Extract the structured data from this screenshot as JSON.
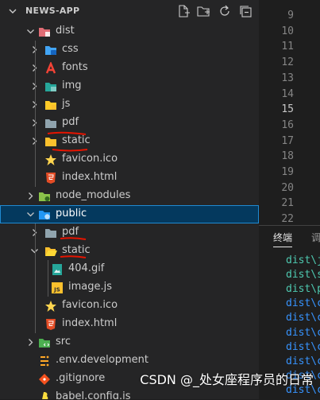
{
  "explorer": {
    "title": "NEWS-APP",
    "actions": [
      {
        "name": "new-file-icon"
      },
      {
        "name": "new-folder-icon"
      },
      {
        "name": "refresh-icon"
      },
      {
        "name": "collapse-all-icon"
      }
    ],
    "tree": [
      {
        "label": "dist",
        "type": "folder",
        "expanded": true,
        "depth": 0,
        "icon": "dist-folder-icon"
      },
      {
        "label": "css",
        "type": "folder",
        "expanded": false,
        "depth": 1,
        "icon": "css-folder-icon"
      },
      {
        "label": "fonts",
        "type": "folder",
        "expanded": false,
        "depth": 1,
        "icon": "fonts-folder-icon"
      },
      {
        "label": "img",
        "type": "folder",
        "expanded": false,
        "depth": 1,
        "icon": "img-folder-icon"
      },
      {
        "label": "js",
        "type": "folder",
        "expanded": false,
        "depth": 1,
        "icon": "js-folder-icon"
      },
      {
        "label": "pdf",
        "type": "folder",
        "expanded": false,
        "depth": 1,
        "icon": "folder-icon"
      },
      {
        "label": "static",
        "type": "folder",
        "expanded": false,
        "depth": 1,
        "icon": "static-folder-icon"
      },
      {
        "label": "favicon.ico",
        "type": "file",
        "depth": 1,
        "icon": "favicon-file-icon"
      },
      {
        "label": "index.html",
        "type": "file",
        "depth": 1,
        "icon": "html-file-icon"
      },
      {
        "label": "node_modules",
        "type": "folder",
        "expanded": false,
        "depth": 0,
        "icon": "node-modules-folder-icon"
      },
      {
        "label": "public",
        "type": "folder",
        "expanded": true,
        "depth": 0,
        "icon": "public-folder-icon",
        "selected": true
      },
      {
        "label": "pdf",
        "type": "folder",
        "expanded": false,
        "depth": 1,
        "icon": "folder-icon"
      },
      {
        "label": "static",
        "type": "folder",
        "expanded": true,
        "depth": 1,
        "icon": "static-folder-open-icon"
      },
      {
        "label": "404.gif",
        "type": "file",
        "depth": 2,
        "icon": "image-file-icon"
      },
      {
        "label": "image.js",
        "type": "file",
        "depth": 2,
        "icon": "js-file-icon"
      },
      {
        "label": "favicon.ico",
        "type": "file",
        "depth": 1,
        "icon": "favicon-file-icon"
      },
      {
        "label": "index.html",
        "type": "file",
        "depth": 1,
        "icon": "html-file-icon"
      },
      {
        "label": "src",
        "type": "folder",
        "expanded": false,
        "depth": 0,
        "icon": "src-folder-icon"
      },
      {
        "label": ".env.development",
        "type": "file",
        "depth": 0,
        "icon": "env-file-icon"
      },
      {
        "label": ".gitignore",
        "type": "file",
        "depth": 0,
        "icon": "git-file-icon"
      },
      {
        "label": "babel.config.js",
        "type": "file",
        "depth": 0,
        "icon": "babel-file-icon"
      }
    ]
  },
  "editor": {
    "line_numbers": [
      "9",
      "10",
      "11",
      "12",
      "13",
      "14",
      "15",
      "16",
      "17",
      "18",
      "19",
      "20",
      "21",
      "22",
      "23"
    ],
    "active_line": "15"
  },
  "panel": {
    "tab_active": "终端",
    "tab_other": "调",
    "terminal_lines": [
      {
        "text": "dist\\j",
        "color": "#4ec9b0"
      },
      {
        "text": "dist\\s",
        "color": "#4ec9b0"
      },
      {
        "text": "dist\\p",
        "color": "#4ec9b0"
      },
      {
        "text": "dist\\c",
        "color": "#3794ff"
      },
      {
        "text": "dist\\c",
        "color": "#3794ff"
      },
      {
        "text": "dist\\c",
        "color": "#3794ff"
      },
      {
        "text": "dist\\c",
        "color": "#3794ff"
      },
      {
        "text": "dist\\c",
        "color": "#3794ff"
      },
      {
        "text": "dist\\c",
        "color": "#3794ff"
      },
      {
        "text": "dist\\c",
        "color": "#3794ff"
      }
    ]
  },
  "watermark": "CSDN @_处女座程序员的日常",
  "colors": {
    "sidebar_bg": "#252526",
    "editor_bg": "#1e1e1e",
    "selection_bg": "#04395e",
    "selection_border": "#1f8ad2",
    "annotation_red": "#e51400"
  }
}
